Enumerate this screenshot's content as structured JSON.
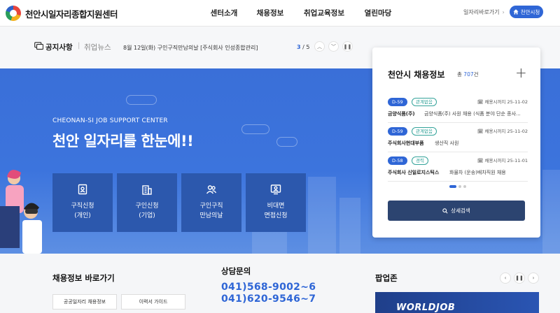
{
  "header": {
    "logo_text": "천안시일자리종합지원센터",
    "nav": [
      "센터소개",
      "채용정보",
      "취업교육정보",
      "열린마당"
    ],
    "quick_link": "일자리바로가기",
    "home_button": "천안시청"
  },
  "notice": {
    "tab_active": "공지사항",
    "tab_inactive": "취업뉴스",
    "text": "8월 12일(화) 구인구직만남의날 [주식회사 인성종합관리]",
    "page_current": "3",
    "page_total": "/ 5"
  },
  "hero": {
    "subtitle": "CHEONAN-SI JOB SUPPORT CENTER",
    "title": "천안 일자리를 한눈에!!",
    "quick_buttons": [
      {
        "line1": "구직신청",
        "line2": "(개인)",
        "icon": "person-card-icon"
      },
      {
        "line1": "구인신청",
        "line2": "(기업)",
        "icon": "building-icon"
      },
      {
        "line1": "구인구직",
        "line2": "만남의날",
        "icon": "people-icon"
      },
      {
        "line1": "비대면",
        "line2": "면접신청",
        "icon": "video-interview-icon"
      }
    ]
  },
  "jobs": {
    "title": "천안시 채용정보",
    "count_prefix": "총",
    "count": "707",
    "count_suffix": "건",
    "items": [
      {
        "dday": "D-59",
        "type": "관계없음",
        "deadline": "채용시까지 25-11-02",
        "company": "금양식품(주)",
        "desc": "금양식품(주) 사원 채용 (식품 분야 단순 종사..."
      },
      {
        "dday": "D-59",
        "type": "관계없음",
        "deadline": "채용시까지 25-11-02",
        "company": "주식회사현대부품",
        "desc": "생산직 사원"
      },
      {
        "dday": "D-58",
        "type": "경력",
        "deadline": "채용시까지 25-11-01",
        "company": "주식회사 신일로지스틱스",
        "desc": "화물차 (운송)배차직원 채용"
      }
    ],
    "detail_button": "상세검색"
  },
  "bottom": {
    "shortcut_title": "채용정보 바로가기",
    "shortcut_links": [
      "공공일자리 채용정보",
      "이력서 가이드"
    ],
    "contact_title": "상담문의",
    "phones": [
      "041)568-9002~6",
      "041)620-9546~7"
    ],
    "popup_title": "팝업존",
    "popup_banner": "WORLDJOB"
  }
}
